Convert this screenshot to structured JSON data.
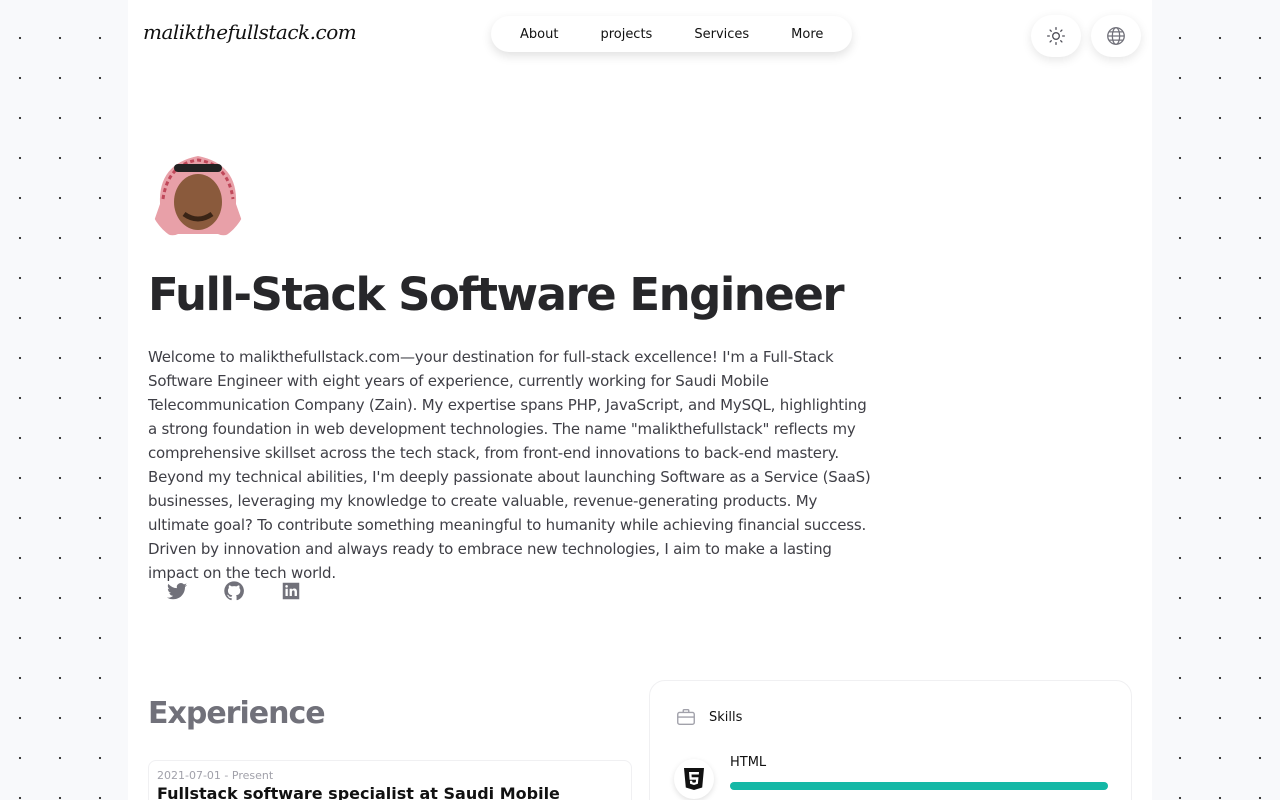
{
  "header": {
    "logo": "malikthefullstack.com",
    "nav": [
      "About",
      "projects",
      "Services",
      "More"
    ],
    "theme_icon": "sun-icon",
    "language_icon": "globe-icon"
  },
  "hero": {
    "title": "Full-Stack Software Engineer",
    "bio": "Welcome to malikthefullstack.com—your destination for full-stack excellence! I'm a Full-Stack Software Engineer with eight years of experience, currently working for Saudi Mobile Telecommunication Company (Zain). My expertise spans PHP, JavaScript, and MySQL, highlighting a strong foundation in web development technologies. The name \"malikthefullstack\" reflects my comprehensive skillset across the tech stack, from front-end innovations to back-end mastery. Beyond my technical abilities, I'm deeply passionate about launching Software as a Service (SaaS) businesses, leveraging my knowledge to create valuable, revenue-generating products. My ultimate goal? To contribute something meaningful to humanity while achieving financial success. Driven by innovation and always ready to embrace new technologies, I aim to make a lasting impact on the tech world.",
    "social": [
      "twitter-icon",
      "github-icon",
      "linkedin-icon"
    ]
  },
  "experience": {
    "title": "Experience",
    "items": [
      {
        "date": "2021-07-01 - Present",
        "role": "Fullstack software specialist at Saudi Mobile"
      }
    ]
  },
  "skills": {
    "title": "Skills",
    "items": [
      {
        "name": "HTML",
        "icon": "html5-icon",
        "level_percent": 100,
        "color": "#14b8a6"
      }
    ]
  }
}
